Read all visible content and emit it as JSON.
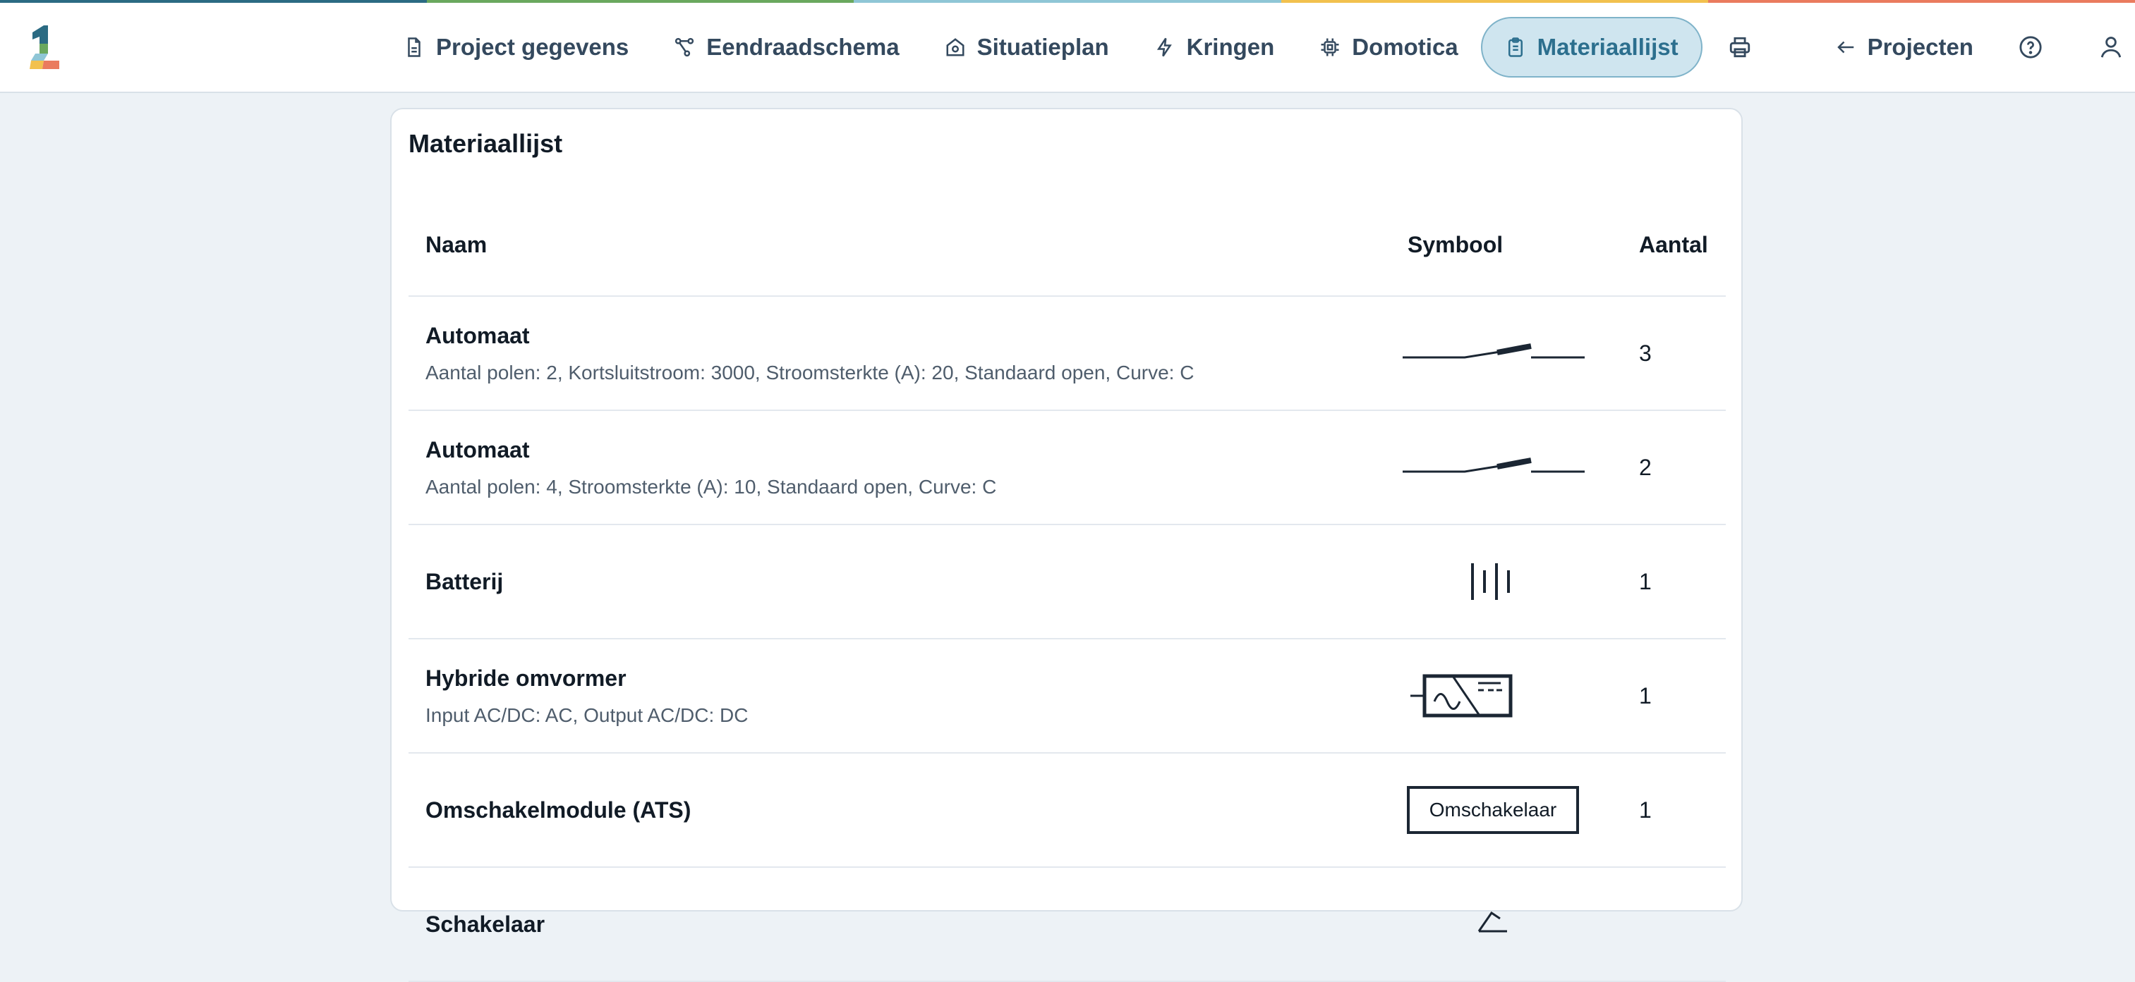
{
  "brand": {
    "strip_colors": [
      "#2b6b83",
      "#6aa85e",
      "#8fc6d6",
      "#f2c14e",
      "#ea7b5e"
    ]
  },
  "nav": {
    "items": [
      {
        "label": "Project gegevens",
        "icon": "document-icon"
      },
      {
        "label": "Eendraadschema",
        "icon": "graph-icon"
      },
      {
        "label": "Situatieplan",
        "icon": "house-icon"
      },
      {
        "label": "Kringen",
        "icon": "bolt-icon"
      },
      {
        "label": "Domotica",
        "icon": "chip-icon"
      },
      {
        "label": "Materiaallijst",
        "icon": "clipboard-icon",
        "active": true
      }
    ],
    "print_icon": "printer-icon",
    "projects_label": "Projecten",
    "help_icon": "help-icon",
    "user_icon": "user-icon"
  },
  "main": {
    "title": "Materiaallijst",
    "columns": {
      "name": "Naam",
      "symbol": "Symbool",
      "quantity": "Aantal"
    },
    "rows": [
      {
        "name": "Automaat",
        "desc": "Aantal polen: 2, Kortsluitstroom: 3000, Stroomsterkte (A): 20, Standaard open, Curve: C",
        "symbol": "breaker-symbol",
        "qty": "3"
      },
      {
        "name": "Automaat",
        "desc": "Aantal polen: 4, Stroomsterkte (A): 10, Standaard open, Curve: C",
        "symbol": "breaker-symbol",
        "qty": "2"
      },
      {
        "name": "Batterij",
        "desc": "",
        "symbol": "battery-symbol",
        "qty": "1"
      },
      {
        "name": "Hybride omvormer",
        "desc": "Input AC/DC: AC, Output AC/DC: DC",
        "symbol": "inverter-symbol",
        "qty": "1"
      },
      {
        "name": "Omschakelmodule (ATS)",
        "desc": "",
        "symbol": "ats-symbol",
        "symbol_label": "Omschakelaar",
        "qty": "1"
      },
      {
        "name": "Schakelaar",
        "desc": "",
        "symbol": "switch-symbol",
        "qty": ""
      }
    ]
  }
}
